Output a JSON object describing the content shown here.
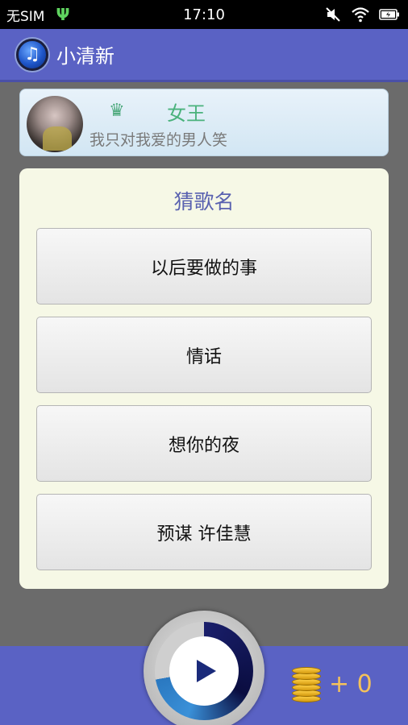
{
  "status_bar": {
    "carrier": "无SIM",
    "time": "17:10"
  },
  "app": {
    "title": "小清新"
  },
  "profile": {
    "name": "女王",
    "signature": "我只对我爱的男人笑"
  },
  "quiz": {
    "title": "猜歌名",
    "options": [
      "以后要做的事",
      "情话",
      "想你的夜",
      "预谋 许佳慧"
    ]
  },
  "coins": {
    "label": "+ 0"
  },
  "colors": {
    "accent": "#5a62c4",
    "name_green": "#4ab27c",
    "coin_text": "#f5c25a"
  }
}
